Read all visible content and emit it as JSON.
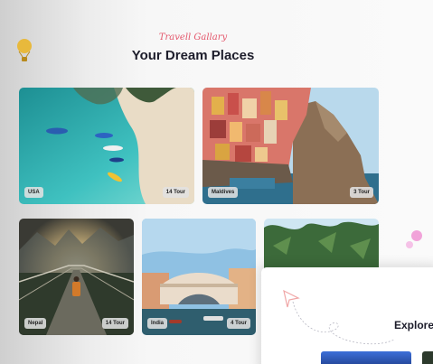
{
  "header": {
    "kicker": "Travell Gallary",
    "title": "Your Dream Places"
  },
  "cards": [
    {
      "location": "USA",
      "tours": "14 Tour"
    },
    {
      "location": "Maldives",
      "tours": "3 Tour"
    },
    {
      "location": "Nepal",
      "tours": "14 Tour"
    },
    {
      "location": "India",
      "tours": "4 Tour"
    }
  ],
  "explore": {
    "title": "Explore"
  },
  "colors": {
    "accent": "#e4566b",
    "title": "#1d1d2b",
    "balloon": "#e8b93c",
    "bubble": "#f1a3d9"
  },
  "icons": {
    "balloon": "hot-air-balloon-icon",
    "plane": "paper-plane-icon"
  }
}
